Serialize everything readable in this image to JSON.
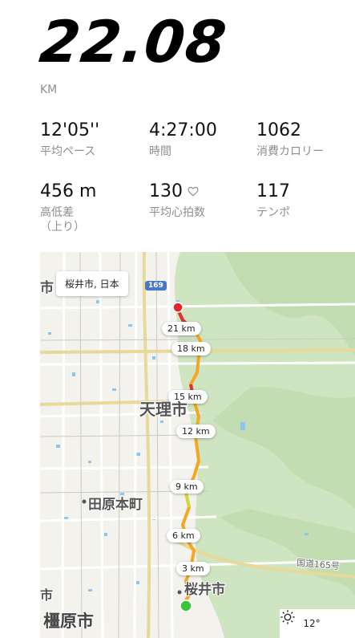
{
  "summary": {
    "distance": "22.08",
    "unit": "KM"
  },
  "stats": [
    {
      "value": "12'05''",
      "label": "平均ペース"
    },
    {
      "value": "4:27:00",
      "label": "時間"
    },
    {
      "value": "1062",
      "label": "消費カロリー"
    },
    {
      "value": "456 m",
      "label": "高低差\n（上り）"
    },
    {
      "value": "130",
      "label": "平均心拍数"
    },
    {
      "value": "117",
      "label": "テンポ"
    }
  ],
  "map": {
    "location": "桜井市, 日本",
    "highway_169": "169",
    "route_markers": [
      "21 km",
      "18 km",
      "15 km",
      "12 km",
      "9 km",
      "6 km",
      "3 km"
    ],
    "places": {
      "edge_top": "市",
      "tenri": "天理市",
      "tawaramoto": "田原本町",
      "sakurai": "桜井市",
      "edge_bottom": "市",
      "kashihara": "橿原市",
      "route165": "国道165号"
    },
    "weather": {
      "temperature": "12°",
      "icon": "sun-icon"
    },
    "colors": {
      "route_orange": "#f5a623",
      "route_red": "#e0302a",
      "start": "#3cc43c",
      "end": "#e3262b"
    }
  }
}
